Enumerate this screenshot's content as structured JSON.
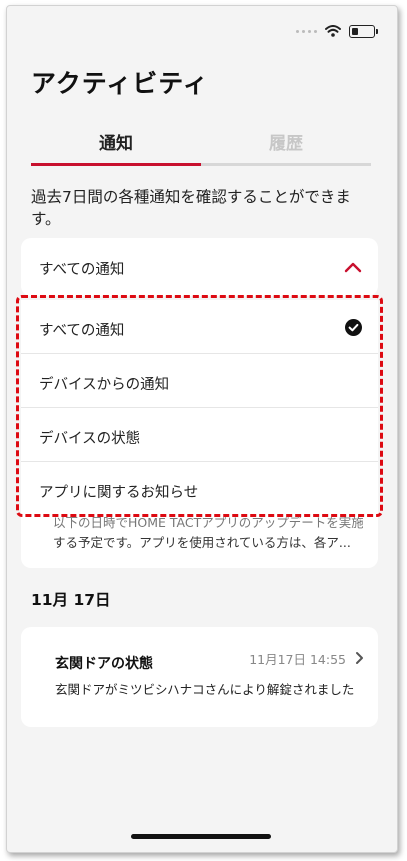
{
  "screen": {
    "title": "アクティビティ"
  },
  "status_bar": {
    "icons": [
      "signal-icon",
      "wifi-icon",
      "battery-icon"
    ],
    "battery_level": 0.3
  },
  "tabs": [
    {
      "label": "通知",
      "active": true
    },
    {
      "label": "履歴",
      "active": false
    }
  ],
  "description": "過去7日間の各種通知を確認することができます。",
  "filter": {
    "selected": "すべての通知",
    "expanded": true,
    "options": [
      {
        "label": "すべての通知",
        "checked": true
      },
      {
        "label": "デバイスからの通知",
        "checked": false
      },
      {
        "label": "デバイスの状態",
        "checked": false
      },
      {
        "label": "アプリに関するお知らせ",
        "checked": false
      }
    ]
  },
  "partial_card": {
    "line1": "以下の日時でHOME TACTアプリのアップデートを実施",
    "line2": "する予定です。アプリを使用されている方は、各ア..."
  },
  "sections": [
    {
      "date": "11月 17日",
      "items": [
        {
          "title": "玄関ドアの状態",
          "time": "11月17日 14:55",
          "body": "玄関ドアがミツビシハナコさんにより解錠されました"
        }
      ]
    }
  ],
  "colors": {
    "accent": "#c8102e",
    "highlight": "#dd0a12",
    "background": "#f4f4f4",
    "card": "#ffffff"
  }
}
